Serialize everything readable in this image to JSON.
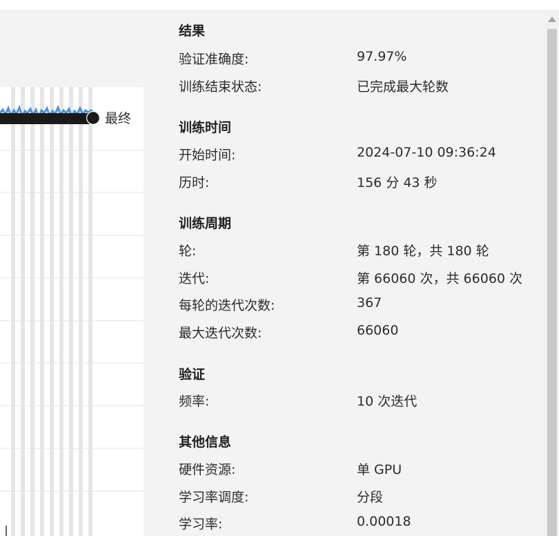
{
  "chart": {
    "final_marker_label": "最终"
  },
  "results": {
    "title": "结果",
    "rows": [
      {
        "label": "验证准确度:",
        "value": "97.97%"
      },
      {
        "label": "训练结束状态:",
        "value": "已完成最大轮数"
      }
    ]
  },
  "training_time": {
    "title": "训练时间",
    "rows": [
      {
        "label": "开始时间:",
        "value": "2024-07-10 09:36:24"
      },
      {
        "label": "历时:",
        "value": "156 分 43 秒"
      }
    ]
  },
  "training_cycle": {
    "title": "训练周期",
    "rows": [
      {
        "label": "轮:",
        "value": "第 180 轮，共 180 轮"
      },
      {
        "label": "迭代:",
        "value": "第 66060 次，共 66060 次"
      },
      {
        "label": "每轮的迭代次数:",
        "value": "367"
      },
      {
        "label": "最大迭代次数:",
        "value": "66060"
      }
    ]
  },
  "validation": {
    "title": "验证",
    "rows": [
      {
        "label": "频率:",
        "value": "10 次迭代"
      }
    ]
  },
  "other_info": {
    "title": "其他信息",
    "rows": [
      {
        "label": "硬件资源:",
        "value": "单 GPU"
      },
      {
        "label": "学习率调度:",
        "value": "分段"
      },
      {
        "label": "学习率:",
        "value": "0.00018"
      }
    ]
  },
  "colors": {
    "training_curve": "#2a7fd4",
    "smoothed_curve": "#1a1a1a",
    "epoch_band": "#e6e6e6",
    "panel_bg": "#f3f3f3"
  }
}
